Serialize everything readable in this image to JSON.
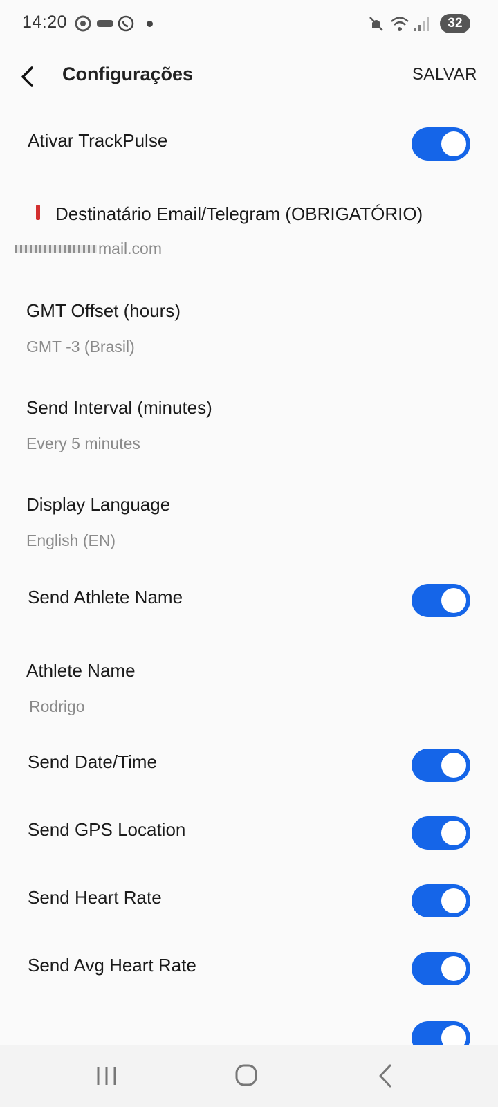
{
  "status_bar": {
    "time": "14:20",
    "battery": "32",
    "icons": [
      "chrome-icon",
      "ifood-icon",
      "whatsapp-icon",
      "notification-dot",
      "mute-icon",
      "wifi-icon",
      "signal-icon",
      "battery-icon"
    ]
  },
  "app_bar": {
    "title": "Configurações",
    "save_label": "SALVAR"
  },
  "settings": {
    "trackpulse_label": "Ativar TrackPulse",
    "trackpulse_on": true,
    "recipient_label": "Destinatário Email/Telegram (OBRIGATÓRIO)",
    "recipient_value_visible": "mail.com",
    "gmt_label": "GMT Offset (hours)",
    "gmt_value": "GMT -3 (Brasil)",
    "interval_label": "Send Interval (minutes)",
    "interval_value": "Every 5 minutes",
    "language_label": "Display Language",
    "language_value": "English (EN)",
    "send_athlete_label": "Send Athlete Name",
    "athlete_name_label": "Athlete Name",
    "athlete_name_value": "Rodrigo",
    "send_datetime_label": "Send Date/Time",
    "send_gps_label": "Send GPS Location",
    "send_hr_label": "Send Heart Rate",
    "send_avg_hr_label": "Send Avg Heart Rate"
  },
  "colors": {
    "accent": "#1565e8",
    "required_marker": "#d32f2f"
  }
}
